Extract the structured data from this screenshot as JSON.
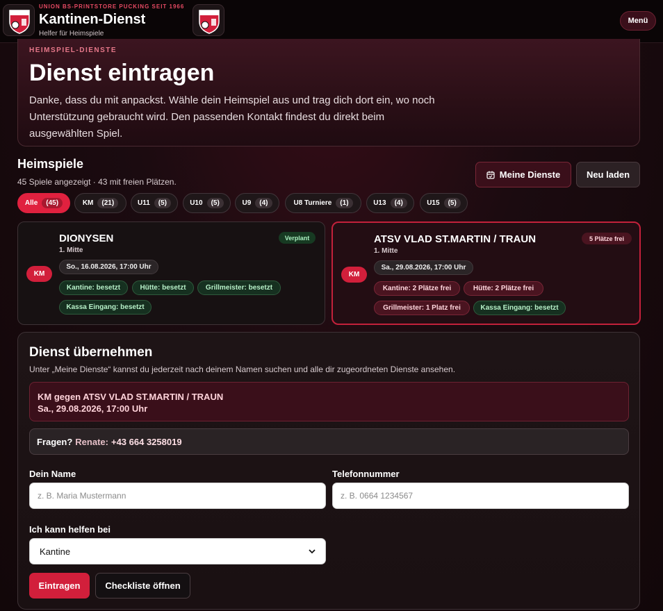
{
  "header": {
    "kicker": "UNION BS-PRINTSTORE PUCKING SEIT 1966",
    "title": "Kantinen-Dienst",
    "tagline": "Helfer für Heimspiele",
    "menu_label": "Menü"
  },
  "hero": {
    "kicker": "HEIMSPIEL-DIENSTE",
    "title": "Dienst eintragen",
    "text": "Danke, dass du mit anpackst. Wähle dein Heimspiel aus und trag dich dort ein, wo noch Unterstützung gebraucht wird. Den passenden Kontakt findest du direkt beim ausgewählten Spiel."
  },
  "games_section": {
    "title": "Heimspiele",
    "summary": "45 Spiele angezeigt · 43 mit freien Plätzen.",
    "my_shifts_label": "Meine Dienste",
    "reload_label": "Neu laden"
  },
  "filters": [
    {
      "label": "Alle",
      "count": "(45)",
      "active": true
    },
    {
      "label": "KM",
      "count": "(21)"
    },
    {
      "label": "U11",
      "count": "(5)"
    },
    {
      "label": "U10",
      "count": "(5)"
    },
    {
      "label": "U9",
      "count": "(4)"
    },
    {
      "label": "U8 Turniere",
      "count": "(1)"
    },
    {
      "label": "U13",
      "count": "(4)"
    },
    {
      "label": "U15",
      "count": "(5)"
    }
  ],
  "games": [
    {
      "team": "KM",
      "opponent": "DIONYSEN",
      "league": "1. Mitte",
      "status": "Verplant",
      "date": "So., 16.08.2026, 17:00 Uhr",
      "slots": [
        "Kantine: besetzt",
        "Hütte: besetzt",
        "Grillmeister: besetzt",
        "Kassa Eingang: besetzt"
      ]
    },
    {
      "team": "KM",
      "opponent": "ATSV VLAD ST.MARTIN / TRAUN",
      "league": "1. Mitte",
      "status": "5 Plätze frei",
      "date": "Sa., 29.08.2026, 17:00 Uhr",
      "slots": [
        "Kantine: 2 Plätze frei",
        "Hütte: 2 Plätze frei",
        "Grillmeister: 1 Platz frei",
        "Kassa Eingang: besetzt"
      ]
    }
  ],
  "form": {
    "title": "Dienst übernehmen",
    "subtitle": "Unter „Meine Dienste“ kannst du jederzeit nach deinem Namen suchen und alle dir zugeordneten Dienste ansehen.",
    "selected_game_line1": "KM gegen ATSV VLAD ST.MARTIN / TRAUN",
    "selected_game_line2": "Sa., 29.08.2026, 17:00 Uhr",
    "contact_label": "Fragen?",
    "contact_name": "Renate:",
    "contact_phone": "+43 664 3258019",
    "name_label": "Dein Name",
    "name_placeholder": "z. B. Maria Mustermann",
    "phone_label": "Telefonnummer",
    "phone_placeholder": "z. B. 0664 1234567",
    "help_label": "Ich kann helfen bei",
    "help_selected": "Kantine",
    "submit_label": "Eintragen",
    "checklist_label": "Checkliste öffnen"
  },
  "colors": {
    "accent": "#d21f3b",
    "background": "#1b0b10",
    "ok": "#b7f0c8"
  }
}
